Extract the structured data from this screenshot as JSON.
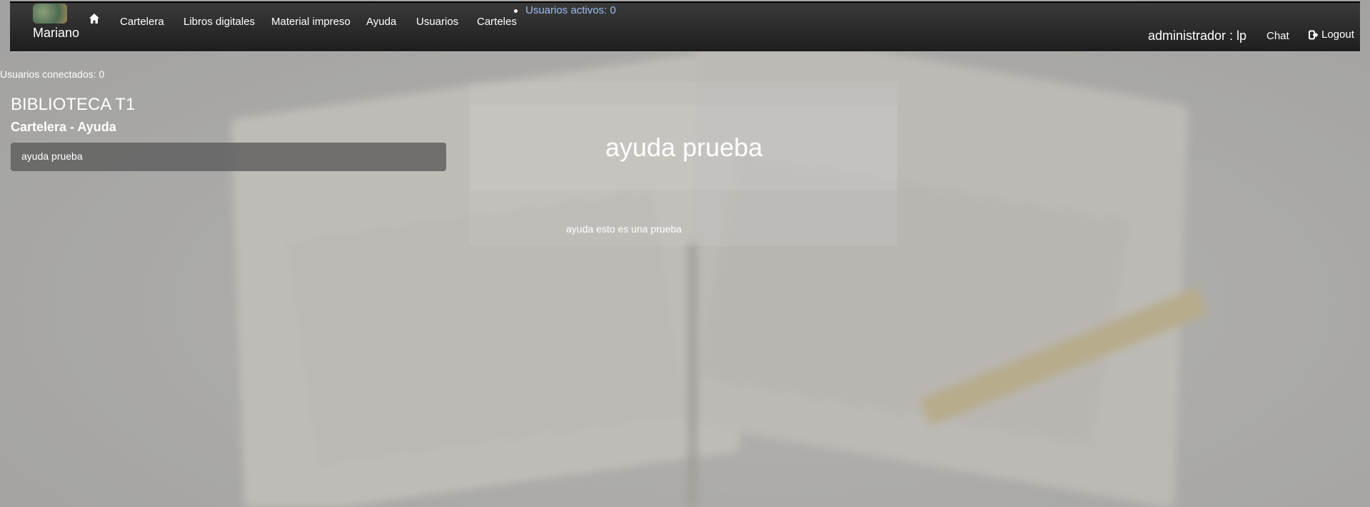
{
  "brand": {
    "name": "Mariano"
  },
  "nav": {
    "items": [
      {
        "label": "Cartelera"
      },
      {
        "label": "Libros digitales"
      },
      {
        "label": "Material impreso"
      },
      {
        "label": "Ayuda"
      },
      {
        "label": "Usuarios"
      },
      {
        "label": "Carteles"
      }
    ],
    "active_users": "Usuarios activos: 0",
    "user": "administrador : lp",
    "chat": "Chat",
    "logout": "Logout"
  },
  "sidebar": {
    "connected": "Usuarios conectados: 0",
    "site_title": "BIBLIOTECA T1",
    "section_title": "Cartelera - Ayuda",
    "items": [
      {
        "label": "ayuda prueba"
      }
    ]
  },
  "article": {
    "title": "ayuda prueba",
    "body": "ayuda esto es una prueba"
  },
  "icons": {
    "home": "home-icon",
    "logout": "logout-icon",
    "logo": "logo-icon"
  }
}
